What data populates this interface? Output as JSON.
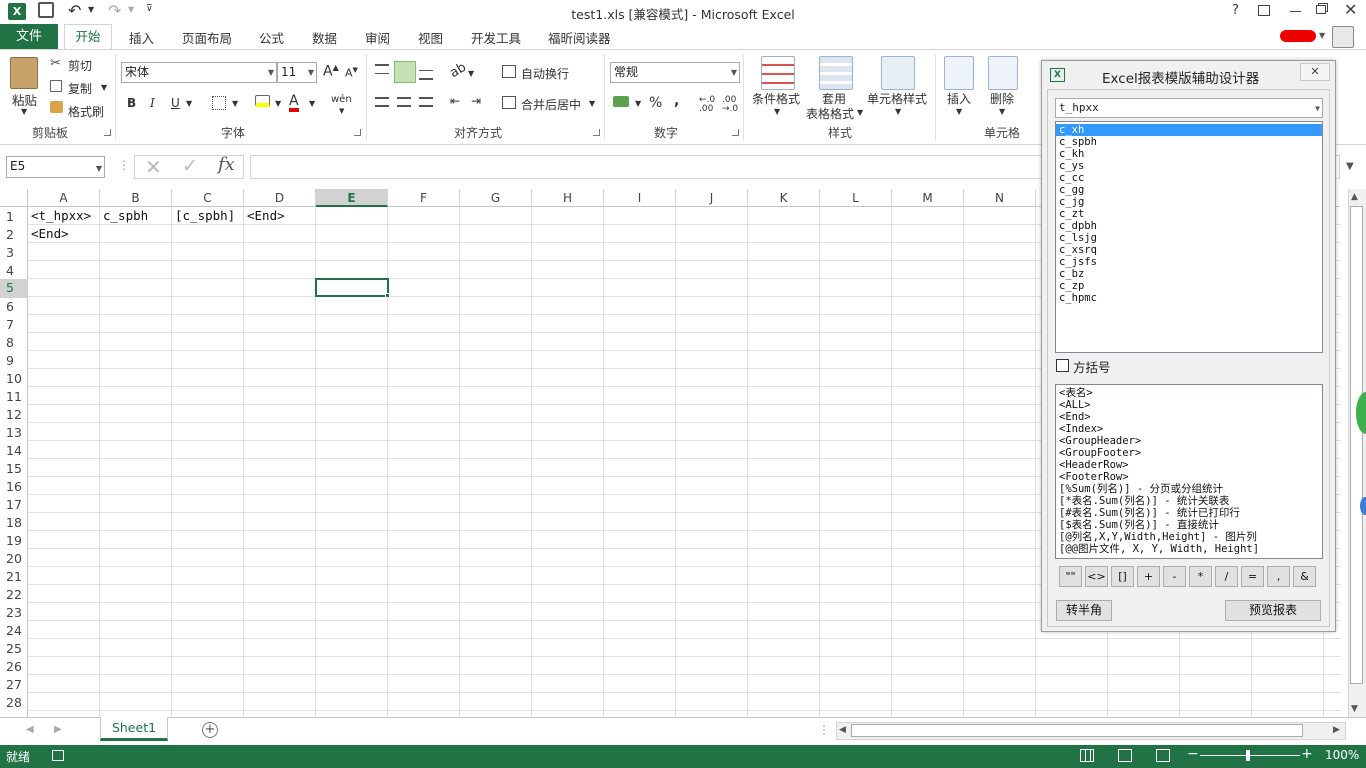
{
  "window": {
    "title": "test1.xls  [兼容模式] - Microsoft Excel",
    "help": "?"
  },
  "tabs": [
    "文件",
    "开始",
    "插入",
    "页面布局",
    "公式",
    "数据",
    "审阅",
    "视图",
    "开发工具",
    "福昕阅读器"
  ],
  "clipboard": {
    "paste": "粘贴",
    "cut": "剪切",
    "copy": "复制",
    "format_painter": "格式刷",
    "group": "剪贴板"
  },
  "font": {
    "name": "宋体",
    "size": "11",
    "bold": "B",
    "italic": "I",
    "underline": "U",
    "wen": "wén",
    "group": "字体"
  },
  "align": {
    "wrap": "自动换行",
    "merge": "合并后居中",
    "group": "对齐方式"
  },
  "number": {
    "format": "常规",
    "percent": "%",
    "comma": ",",
    "group": "数字"
  },
  "styles": {
    "cond": "条件格式",
    "table1": "套用",
    "table2": "表格格式",
    "cell": "单元格样式",
    "group": "样式"
  },
  "cells": {
    "insert": "插入",
    "delete": "删除",
    "group": "单元格"
  },
  "formula": {
    "namebox": "E5",
    "fx": "fx"
  },
  "columns": [
    "A",
    "B",
    "C",
    "D",
    "E",
    "F",
    "G",
    "H",
    "I",
    "J",
    "K",
    "L",
    "M",
    "N"
  ],
  "rows": [
    "1",
    "2",
    "3",
    "4",
    "5",
    "6",
    "7",
    "8",
    "9",
    "10",
    "11",
    "12",
    "13",
    "14",
    "15",
    "16",
    "17",
    "18",
    "19",
    "20",
    "21",
    "22",
    "23",
    "24",
    "25",
    "26",
    "27",
    "28"
  ],
  "grid": {
    "a1": "<t_hpxx>",
    "b1": "c_spbh",
    "c1": "[c_spbh]",
    "d1": "<End>",
    "a2": "<End>"
  },
  "sheet": {
    "tab": "Sheet1",
    "add": "+"
  },
  "status": {
    "ready": "就绪",
    "zoom": "100%"
  },
  "panel": {
    "title": "Excel报表模版辅助设计器",
    "close": "✕",
    "table_select": "t_hpxx",
    "fields": [
      "c_xh",
      "c_spbh",
      "c_kh",
      "c_ys",
      "c_cc",
      "c_gg",
      "c_jg",
      "c_zt",
      "c_dpbh",
      "c_lsjg",
      "c_xsrq",
      "c_jsfs",
      "c_bz",
      "c_zp",
      "c_hpmc"
    ],
    "selected_field": "c_xh",
    "bracket_label": "方括号",
    "templates": [
      "<表名>",
      "<ALL>",
      "<End>",
      "<Index>",
      "<GroupHeader>",
      "<GroupFooter>",
      "<HeaderRow>",
      "<FooterRow>",
      "[%Sum(列名)] - 分页或分组统计",
      "[*表名.Sum(列名)] - 统计关联表",
      "[#表名.Sum(列名)] - 统计已打印行",
      "[$表名.Sum(列名)] - 直接统计",
      "[@列名,X,Y,Width,Height] - 图片列",
      "[@@图片文件, X, Y, Width, Height]"
    ],
    "symbols": [
      "\"\"",
      "<>",
      "[]",
      "+",
      "-",
      "*",
      "/",
      "=",
      ",",
      "&"
    ],
    "half_width": "转半角",
    "preview": "预览报表"
  }
}
